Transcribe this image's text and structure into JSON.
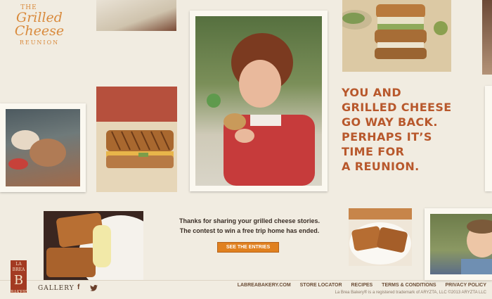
{
  "logo": {
    "the": "THE",
    "main_line1": "Grilled",
    "main_line2": "Cheese",
    "sub": "REUNION"
  },
  "headline": {
    "lines": [
      "YOU AND",
      "GRILLED CHEESE",
      "GO WAY BACK.",
      "PERHAPS IT’S",
      "TIME FOR",
      "A REUNION."
    ]
  },
  "message": {
    "line1": "Thanks for sharing your grilled cheese stories.",
    "line2": "The contest to win a free trip home has ended."
  },
  "cta": {
    "entries_label": "SEE THE ENTRIES"
  },
  "footer": {
    "brand": {
      "top": "LA BREA",
      "mark": "B",
      "bottom": "BAKERY"
    },
    "gallery_label": "GALLERY",
    "facebook_glyph": "f",
    "links": [
      "LABREABAKERY.COM",
      "STORE LOCATOR",
      "RECIPES",
      "TERMS & CONDITIONS",
      "PRIVACY POLICY"
    ],
    "copyright": "La Brea Bakery® is a registered trademark of ARYZTA, LLC ©2013 ARYZTA LLC"
  },
  "colors": {
    "accent": "#b8582c",
    "button": "#e0801f",
    "background": "#f1ece1"
  }
}
